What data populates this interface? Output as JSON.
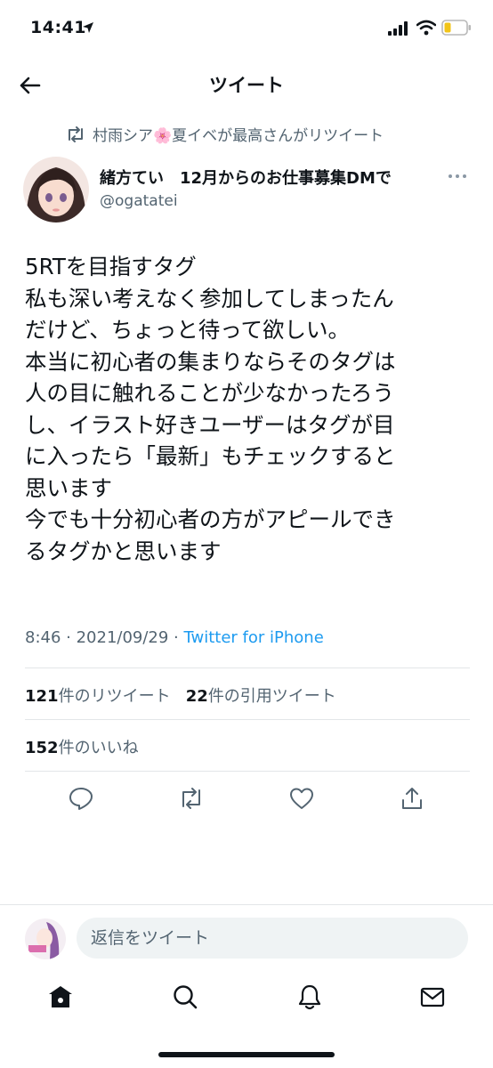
{
  "status_bar": {
    "time": "14:41"
  },
  "header": {
    "title": "ツイート"
  },
  "retweet_notice": "村雨シア🌸夏イベが最高さんがリツイート",
  "author": {
    "name": "緒方てい　12月からのお仕事募集DMで",
    "handle": "@ogatatei"
  },
  "tweet": {
    "lines": [
      "5RTを目指すタグ",
      "私も深い考えなく参加してしまったん",
      "だけど、ちょっと待って欲しい。",
      "本当に初心者の集まりならそのタグは",
      "人の目に触れることが少なかったろう",
      "し、イラスト好きユーザーはタグが目",
      "に入ったら「最新」もチェックすると",
      "思います",
      "今でも十分初心者の方がアピールでき",
      "るタグかと思います"
    ]
  },
  "meta": {
    "time_date": "8:46 · 2021/09/29 · ",
    "source": "Twitter for iPhone"
  },
  "stats": {
    "retweets_count": "121",
    "retweets_label": "件のリツイート",
    "quotes_count": "22",
    "quotes_label": "件の引用ツイート",
    "likes_count": "152",
    "likes_label": "件のいいね"
  },
  "actions": [
    "reply-icon",
    "retweet-icon",
    "like-icon",
    "share-icon"
  ],
  "reply_bar": {
    "placeholder": "返信をツイート"
  },
  "tab_bar": [
    "home-icon",
    "search-icon",
    "notifications-icon",
    "messages-icon"
  ],
  "colors": {
    "accent": "#1d9bf0",
    "secondary_text": "#536471",
    "text": "#0f1419"
  }
}
